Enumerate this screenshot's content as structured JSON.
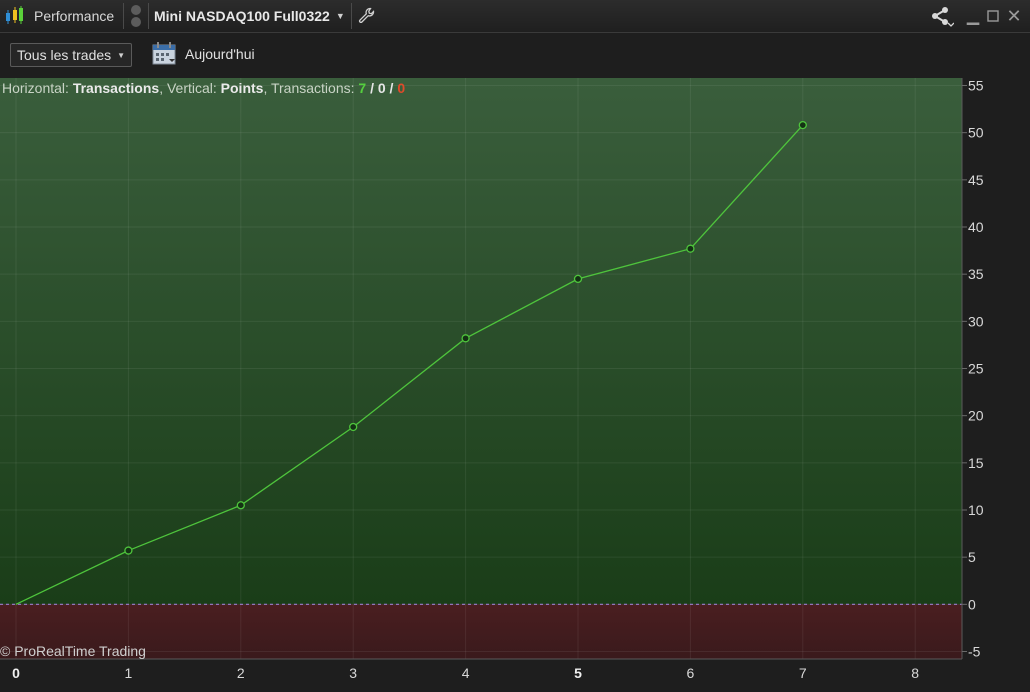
{
  "titlebar": {
    "performance_label": "Performance",
    "instrument_label": "Mini NASDAQ100 Full0322",
    "icons": [
      "candlestick-icon",
      "link-icon",
      "chevron-down-icon",
      "wrench-icon",
      "share-icon",
      "minimize-icon",
      "maximize-icon",
      "close-icon"
    ]
  },
  "toolbar": {
    "trades_filter": "Tous les trades",
    "today_label": "Aujourd'hui"
  },
  "header": {
    "horizontal_label": "Horizontal:",
    "horizontal_value": "Transactions",
    "vertical_label": "Vertical:",
    "vertical_value": "Points",
    "transactions_label": "Transactions:",
    "won": "7",
    "neutral": "0",
    "lost": "0"
  },
  "copyright": "© ProRealTime Trading",
  "colors": {
    "positive_zone": "#1f4a20",
    "negative_zone": "#421c1e",
    "line": "#4ec43c",
    "zero_line": "#9a7fd0"
  },
  "chart_data": {
    "type": "line",
    "x": [
      0,
      1,
      2,
      3,
      4,
      5,
      6,
      7
    ],
    "y": [
      0,
      5.7,
      10.5,
      18.8,
      28.2,
      34.5,
      37.7,
      50.8
    ],
    "xlim": [
      0,
      8.4
    ],
    "ylim": [
      -5,
      55
    ],
    "x_ticks": [
      "0",
      "1",
      "2",
      "3",
      "4",
      "5",
      "6",
      "7",
      "8"
    ],
    "y_ticks": [
      "55",
      "50",
      "45",
      "40",
      "35",
      "30",
      "25",
      "20",
      "15",
      "10",
      "5",
      "0",
      "-5"
    ],
    "grid": true
  }
}
